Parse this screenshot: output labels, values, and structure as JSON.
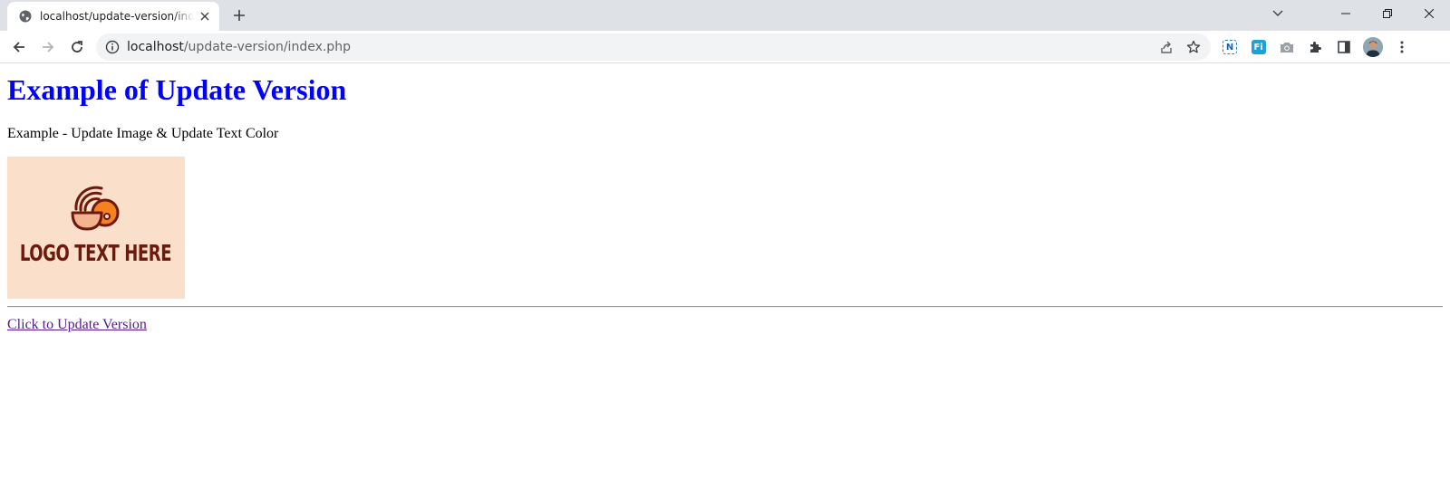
{
  "browser": {
    "tab": {
      "title": "localhost/update-version/index.php",
      "favicon": "globe-icon"
    },
    "address": {
      "host": "localhost",
      "path": "/update-version/index.php"
    },
    "extensions": [
      {
        "name": "n-extension-icon",
        "label": "N",
        "color": "#1a73e8"
      },
      {
        "name": "fi-extension-icon",
        "label": "Fi",
        "color": "#1ea0d8"
      }
    ]
  },
  "page": {
    "heading": "Example of Update Version",
    "subtitle": "Example - Update Image & Update Text Color",
    "logo_text": "LOGO TEXT HERE",
    "link_label": "Click to Update Version"
  },
  "colors": {
    "heading": "#0000ff",
    "visited_link": "#551a8b",
    "logo_background": "#fadfca",
    "logo_text": "#6b1a0d",
    "logo_accent": "#f5821f"
  }
}
